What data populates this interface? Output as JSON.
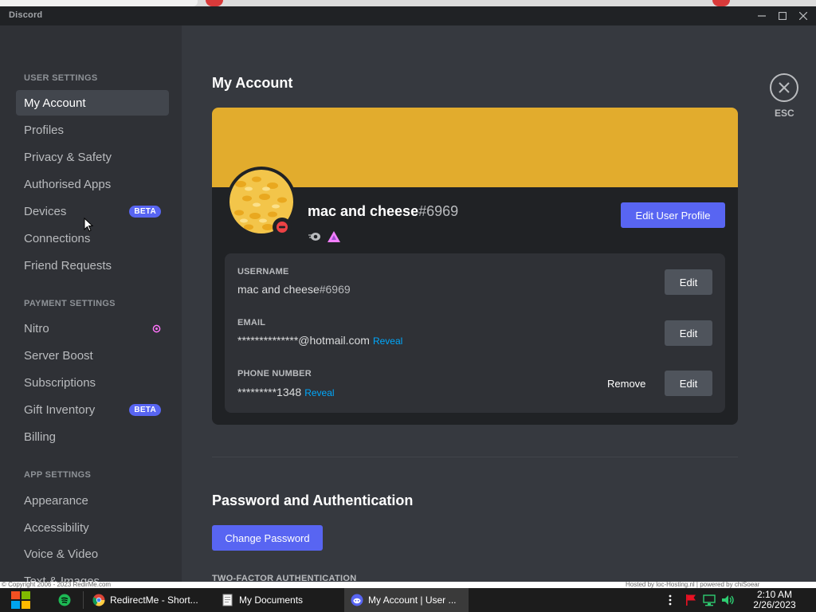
{
  "window": {
    "app_title": "Discord",
    "controls": {
      "minimize_icon": "minimize-icon",
      "maximize_icon": "maximize-icon",
      "close_icon": "close-icon"
    }
  },
  "sidebar": {
    "user_settings_head": "USER SETTINGS",
    "user_items": [
      {
        "label": "My Account",
        "selected": true
      },
      {
        "label": "Profiles"
      },
      {
        "label": "Privacy & Safety"
      },
      {
        "label": "Authorised Apps"
      },
      {
        "label": "Devices",
        "badge": "BETA"
      },
      {
        "label": "Connections"
      },
      {
        "label": "Friend Requests"
      }
    ],
    "payment_settings_head": "PAYMENT SETTINGS",
    "payment_items": [
      {
        "label": "Nitro",
        "icon": "nitro-icon"
      },
      {
        "label": "Server Boost"
      },
      {
        "label": "Subscriptions"
      },
      {
        "label": "Gift Inventory",
        "badge": "BETA"
      },
      {
        "label": "Billing"
      }
    ],
    "app_settings_head": "APP SETTINGS",
    "app_items": [
      {
        "label": "Appearance"
      },
      {
        "label": "Accessibility"
      },
      {
        "label": "Voice & Video"
      },
      {
        "label": "Text & Images"
      }
    ]
  },
  "main": {
    "title": "My Account",
    "esc_label": "ESC",
    "profile": {
      "banner_color": "#e2ac2d",
      "name": "mac and cheese",
      "discriminator": "#6969",
      "edit_profile_label": "Edit User Profile",
      "status": "do-not-disturb"
    },
    "fields": {
      "username": {
        "label": "USERNAME",
        "name": "mac and cheese",
        "discriminator": "#6969",
        "edit_label": "Edit"
      },
      "email": {
        "label": "EMAIL",
        "value": "**************@hotmail.com",
        "reveal_label": "Reveal",
        "edit_label": "Edit"
      },
      "phone": {
        "label": "PHONE NUMBER",
        "value": "*********1348",
        "reveal_label": "Reveal",
        "remove_label": "Remove",
        "edit_label": "Edit"
      }
    },
    "password_section": {
      "title": "Password and Authentication",
      "change_password_label": "Change Password",
      "two_factor_head": "TWO-FACTOR AUTHENTICATION"
    }
  },
  "footer": {
    "copyright": "© Copyright 2006 - 2023 RedirMe.com",
    "hosted": "Hosted by loc-Hosting.nl  |  powered by chiSoear"
  },
  "taskbar": {
    "items": [
      {
        "label": "RedirectMe - Short...",
        "icon": "chrome-icon"
      },
      {
        "label": "My Documents",
        "icon": "folder-icon"
      },
      {
        "label": "My Account | User ...",
        "icon": "discord-icon",
        "active": true
      }
    ],
    "time": "2:10 AM",
    "date": "2/26/2023"
  },
  "colors": {
    "accent": "#5865f2",
    "sidebar_bg": "#2f3136",
    "main_bg": "#36393f",
    "card_bg": "#202225",
    "link": "#00a8fc"
  }
}
